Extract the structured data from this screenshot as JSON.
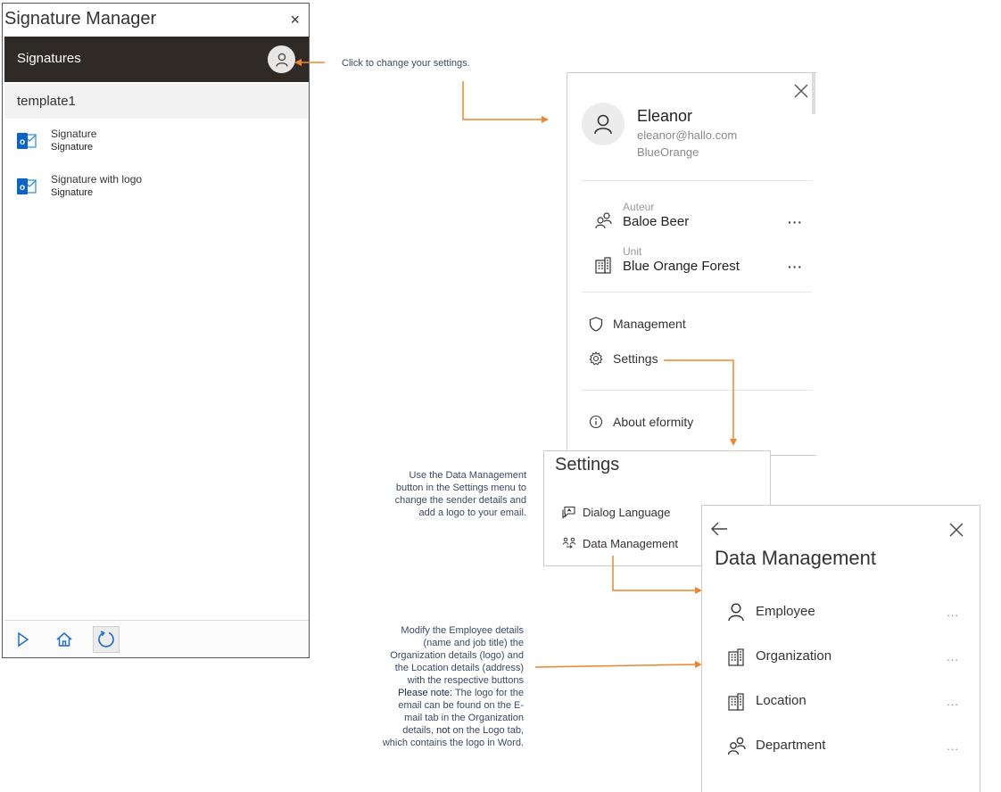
{
  "signature_manager": {
    "title": "Signature Manager",
    "close_glyph": "×",
    "header_label": "Signatures",
    "avatar_icon": "user-icon",
    "template_name": "template1",
    "signatures": [
      {
        "name": "Signature",
        "type": "Signature",
        "icon": "outlook-icon"
      },
      {
        "name": "Signature with logo",
        "type": "Signature",
        "icon": "outlook-icon"
      }
    ],
    "footer_icons": [
      "play-icon",
      "home-icon",
      "refresh-icon"
    ]
  },
  "profile_panel": {
    "name": "Eleanor",
    "email": "eleanor@hallo.com",
    "company": "BlueOrange",
    "author_label": "Auteur",
    "author_value": "Baloe Beer",
    "unit_label": "Unit",
    "unit_value": "Blue Orange Forest",
    "more_glyph": "···",
    "management_label": "Management",
    "settings_label": "Settings",
    "about_label": "About eformity"
  },
  "settings_panel": {
    "title": "Settings",
    "dialog_language_label": "Dialog Language",
    "data_management_label": "Data Management"
  },
  "data_management_panel": {
    "title": "Data Management",
    "more_glyph": "...",
    "items": [
      {
        "label": "Employee",
        "icon": "person-icon"
      },
      {
        "label": "Organization",
        "icon": "building-icon"
      },
      {
        "label": "Location",
        "icon": "building-icon"
      },
      {
        "label": "Department",
        "icon": "people-icon"
      }
    ]
  },
  "annotations": {
    "settings_hint": "Click to change your settings.",
    "data_mgmt_hint": [
      "Use the Data Management",
      "button in the Settings menu to",
      "change the sender details and",
      "add a logo to your email."
    ],
    "modify_hint": [
      "Modify the Employee details",
      "(name and job title) the",
      "Organization details (logo) and",
      "the Location details (address)",
      "with the respective buttons"
    ],
    "please_note_label": "Please note:",
    "please_note_first": " The logo for the",
    "please_note_lines": [
      "email can be found on the E-",
      "mail tab in the Organization"
    ],
    "details_prefix": "details, ",
    "not_word": "not",
    "details_suffix": " on the Logo tab,",
    "last_line": "which contains the logo in Word."
  },
  "colors": {
    "accent_orange": "#f0862c",
    "header_dark": "#2f2a25",
    "outlook_blue": "#0a64c8"
  }
}
